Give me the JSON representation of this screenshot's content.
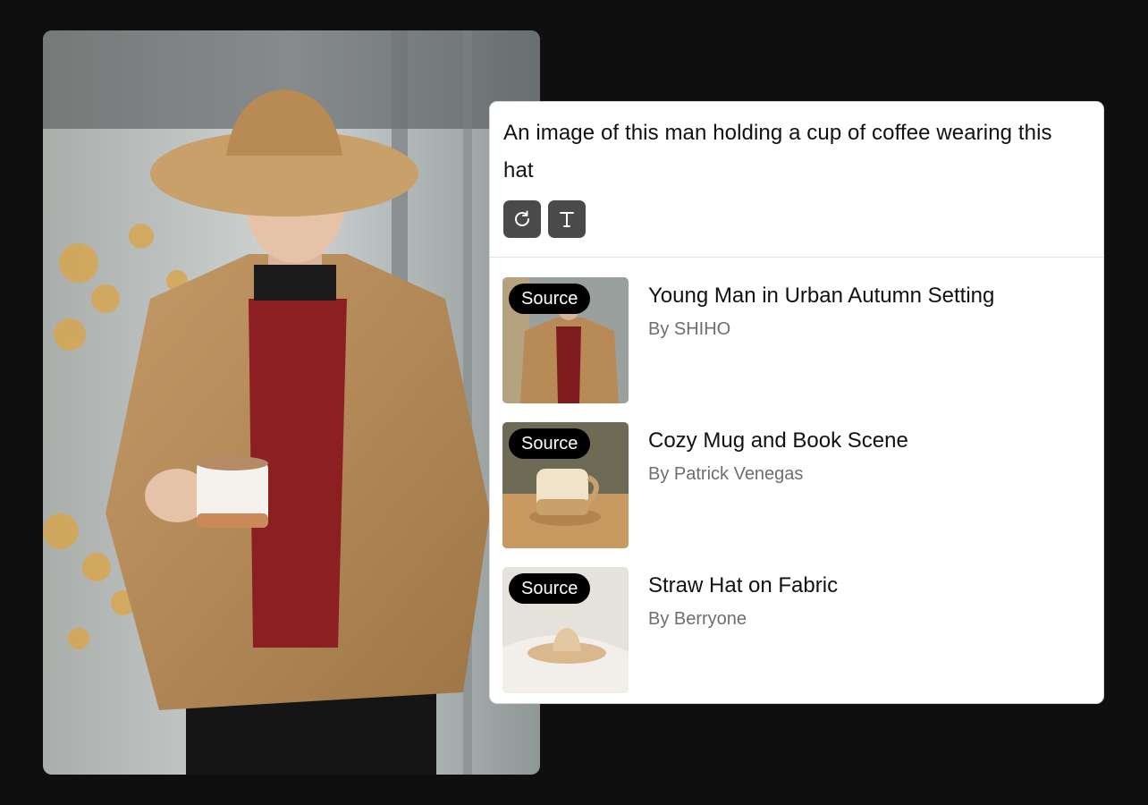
{
  "prompt": {
    "text": "An image of this man holding a cup of coffee wearing this hat"
  },
  "actions": [
    {
      "icon": "refresh-icon"
    },
    {
      "icon": "text-icon"
    }
  ],
  "results": [
    {
      "badge": "Source",
      "title": "Young Man in Urban Autumn Setting",
      "author": "By SHIHO",
      "thumb_icon": "man-jacket-thumbnail"
    },
    {
      "badge": "Source",
      "title": "Cozy Mug and Book Scene",
      "author": "By Patrick Venegas",
      "thumb_icon": "mug-thumbnail"
    },
    {
      "badge": "Source",
      "title": "Straw Hat on Fabric",
      "author": "By Berryone",
      "thumb_icon": "straw-hat-thumbnail"
    }
  ],
  "colors": {
    "background": "#0f0f0f",
    "card": "#ffffff",
    "button": "#4a4a4a",
    "badge": "#000000",
    "author_text": "#6e6e6e"
  }
}
